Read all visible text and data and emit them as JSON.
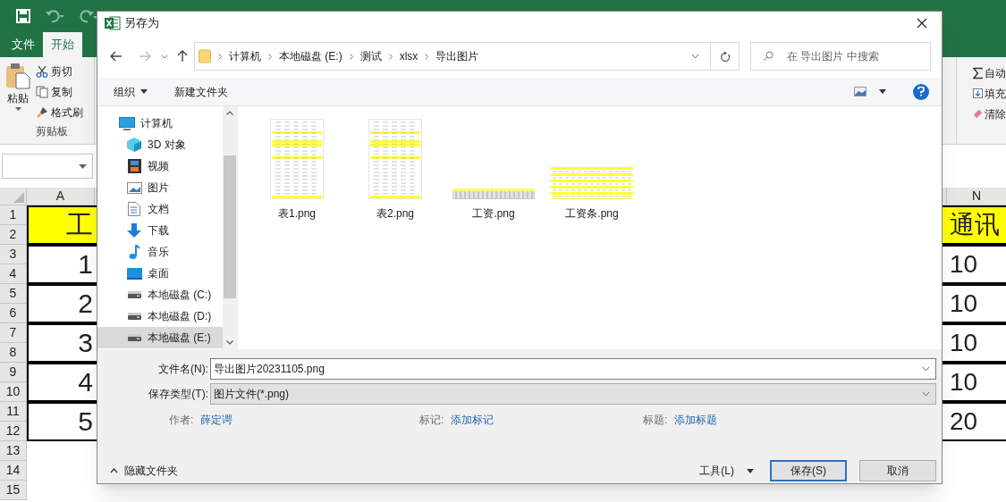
{
  "excel": {
    "tabs": [
      {
        "label": "文件",
        "selected": false
      },
      {
        "label": "开始",
        "selected": true
      }
    ],
    "clipboard": {
      "paste": "粘贴",
      "cut": "剪切",
      "copy": "复制",
      "format_painter": "格式刷",
      "group_label": "剪贴板"
    },
    "editing": {
      "autosum": "自动",
      "fill": "填充",
      "clear": "清除"
    },
    "columns": [
      "A",
      "N"
    ],
    "row_numbers": [
      "1",
      "2",
      "3",
      "4",
      "5",
      "6",
      "7",
      "8",
      "9",
      "10",
      "11",
      "12",
      "13",
      "14",
      "15"
    ],
    "rows": [
      {
        "kind": "header",
        "a": "工",
        "n": "通讯"
      },
      {
        "kind": "data",
        "a": "1",
        "n": "10"
      },
      {
        "kind": "data",
        "a": "2",
        "n": "10"
      },
      {
        "kind": "data",
        "a": "3",
        "n": "10"
      },
      {
        "kind": "data",
        "a": "4",
        "n": "10"
      },
      {
        "kind": "data",
        "a": "5",
        "n": "20"
      }
    ]
  },
  "dialog": {
    "title": "另存为",
    "breadcrumb": [
      "计算机",
      "本地磁盘 (E:)",
      "测试",
      "xlsx",
      "导出图片"
    ],
    "search": {
      "placeholder": "在 导出图片 中搜索"
    },
    "toolbar": {
      "organize": "组织",
      "new_folder": "新建文件夹"
    },
    "sidebar": [
      {
        "label": "计算机",
        "kind": "computer",
        "selected": false,
        "children": [
          {
            "label": "3D 对象",
            "kind": "cube",
            "selected": false
          },
          {
            "label": "视频",
            "kind": "film",
            "selected": false
          },
          {
            "label": "图片",
            "kind": "image",
            "selected": false
          },
          {
            "label": "文档",
            "kind": "document",
            "selected": false
          },
          {
            "label": "下载",
            "kind": "download",
            "selected": false
          },
          {
            "label": "音乐",
            "kind": "music",
            "selected": false
          },
          {
            "label": "桌面",
            "kind": "desktop",
            "selected": false
          },
          {
            "label": "本地磁盘 (C:)",
            "kind": "drive",
            "selected": false
          },
          {
            "label": "本地磁盘 (D:)",
            "kind": "drive",
            "selected": false
          },
          {
            "label": "本地磁盘 (E:)",
            "kind": "drive",
            "selected": true
          }
        ]
      }
    ],
    "files": [
      {
        "name": "表1.png",
        "kind": "tall"
      },
      {
        "name": "表2.png",
        "kind": "tall"
      },
      {
        "name": "工资.png",
        "kind": "strip"
      },
      {
        "name": "工资条.png",
        "kind": "wide"
      }
    ],
    "filename": {
      "label": "文件名(N):",
      "value": "导出图片20231105.png"
    },
    "file_type": {
      "label": "保存类型(T):",
      "value": "图片文件(*.png)"
    },
    "metadata": [
      {
        "label": "作者:",
        "value": "薛定谔"
      },
      {
        "label": "标记:",
        "value": "添加标记"
      },
      {
        "label": "标题:",
        "value": "添加标题"
      }
    ],
    "hide_folders": "隐藏文件夹",
    "tools": "工具(L)",
    "buttons": [
      {
        "label": "保存(S)",
        "default": true
      },
      {
        "label": "取消",
        "default": false
      }
    ]
  }
}
